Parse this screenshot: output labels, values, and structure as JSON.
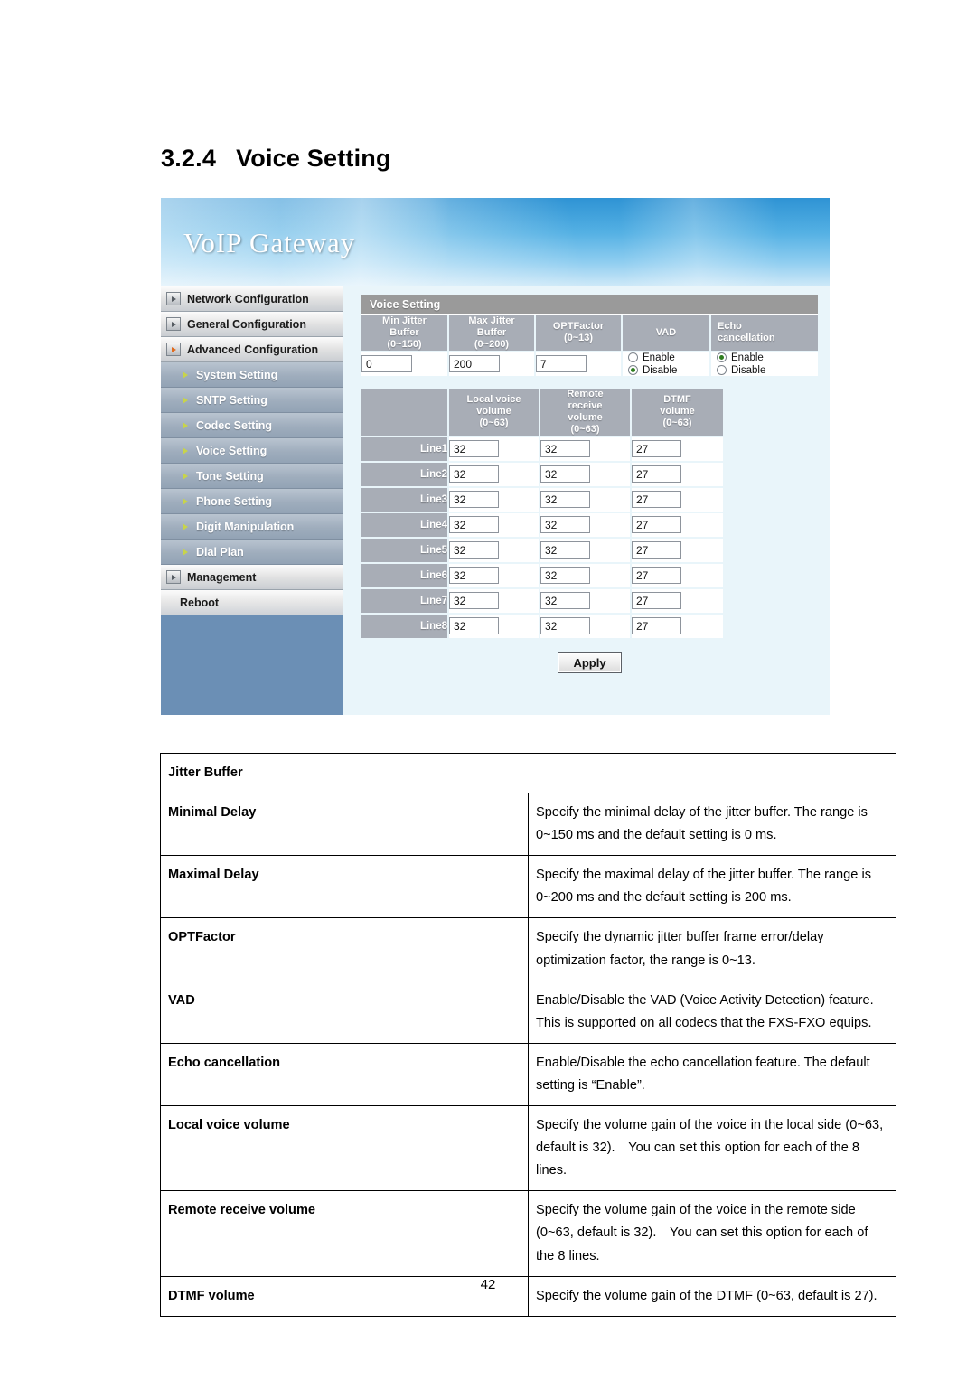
{
  "document": {
    "section_number": "3.2.4",
    "section_title": "Voice Setting",
    "page_number": "42"
  },
  "webui": {
    "banner_title": "VoIP Gateway",
    "panel_title": "Voice Setting",
    "apply_label": "Apply",
    "nav": {
      "top_items": [
        {
          "label": "Network Configuration",
          "active": false
        },
        {
          "label": "General Configuration",
          "active": false
        },
        {
          "label": "Advanced Configuration",
          "active": true
        }
      ],
      "sub_items": [
        {
          "label": "System Setting"
        },
        {
          "label": "SNTP Setting"
        },
        {
          "label": "Codec Setting"
        },
        {
          "label": "Voice Setting"
        },
        {
          "label": "Tone Setting"
        },
        {
          "label": "Phone Setting"
        },
        {
          "label": "Digit Manipulation"
        },
        {
          "label": "Dial Plan"
        }
      ],
      "management_label": "Management",
      "reboot_label": "Reboot"
    },
    "jitter_table": {
      "headers": [
        "Min Jitter Buffer (0~150)",
        "Max Jitter Buffer (0~200)",
        "OPTFactor (0~13)",
        "VAD",
        "Echo cancellation"
      ],
      "header_lines": {
        "min_jitter": [
          "Min Jitter",
          "Buffer",
          "(0~150)"
        ],
        "max_jitter": [
          "Max Jitter",
          "Buffer",
          "(0~200)"
        ],
        "optfactor": [
          "OPTFactor",
          "(0~13)"
        ],
        "vad": [
          "VAD"
        ],
        "echo": [
          "Echo",
          "cancellation"
        ]
      },
      "values": {
        "min_jitter_buffer": "0",
        "max_jitter_buffer": "200",
        "optfactor": "7"
      },
      "vad": {
        "enable_label": "Enable",
        "disable_label": "Disable",
        "selected": "Disable"
      },
      "echo_cancellation": {
        "enable_label": "Enable",
        "disable_label": "Disable",
        "selected": "Enable"
      }
    },
    "volume_table": {
      "header_lines": {
        "local": [
          "Local voice",
          "volume",
          "(0~63)"
        ],
        "remote": [
          "Remote",
          "receive",
          "volume",
          "(0~63)"
        ],
        "dtmf": [
          "DTMF",
          "volume",
          "(0~63)"
        ]
      },
      "rows": [
        {
          "line": "Line1",
          "local": "32",
          "remote": "32",
          "dtmf": "27"
        },
        {
          "line": "Line2",
          "local": "32",
          "remote": "32",
          "dtmf": "27"
        },
        {
          "line": "Line3",
          "local": "32",
          "remote": "32",
          "dtmf": "27"
        },
        {
          "line": "Line4",
          "local": "32",
          "remote": "32",
          "dtmf": "27"
        },
        {
          "line": "Line5",
          "local": "32",
          "remote": "32",
          "dtmf": "27"
        },
        {
          "line": "Line6",
          "local": "32",
          "remote": "32",
          "dtmf": "27"
        },
        {
          "line": "Line7",
          "local": "32",
          "remote": "32",
          "dtmf": "27"
        },
        {
          "line": "Line8",
          "local": "32",
          "remote": "32",
          "dtmf": "27"
        }
      ]
    }
  },
  "doc_table": {
    "group_header": "Jitter Buffer",
    "rows": [
      {
        "term": "Minimal Delay",
        "desc": "Specify the minimal delay of the jitter buffer. The range is 0~150 ms and the default setting is 0 ms."
      },
      {
        "term": "Maximal Delay",
        "desc": "Specify the maximal delay of the jitter buffer. The range is 0~200 ms and the default setting is 200 ms."
      },
      {
        "term": "OPTFactor",
        "desc": "Specify the dynamic jitter buffer frame error/delay optimization factor, the range is 0~13."
      },
      {
        "term": "VAD",
        "desc": "Enable/Disable the VAD (Voice Activity Detection) feature. This is supported on all codecs that the FXS-FXO equips."
      },
      {
        "term": "Echo cancellation",
        "desc": "Enable/Disable the echo cancellation feature. The default setting is “Enable”."
      },
      {
        "term": "Local voice volume",
        "desc": "Specify the volume gain of the voice in the local side (0~63, default is 32). You can set this option for each of the 8 lines."
      },
      {
        "term": "Remote receive volume",
        "desc": "Specify the volume gain of the voice in the remote side (0~63, default is 32). You can set this option for each of the 8 lines."
      },
      {
        "term": "DTMF volume",
        "desc": "Specify the volume gain of the DTMF (0~63, default is 27)."
      }
    ]
  }
}
